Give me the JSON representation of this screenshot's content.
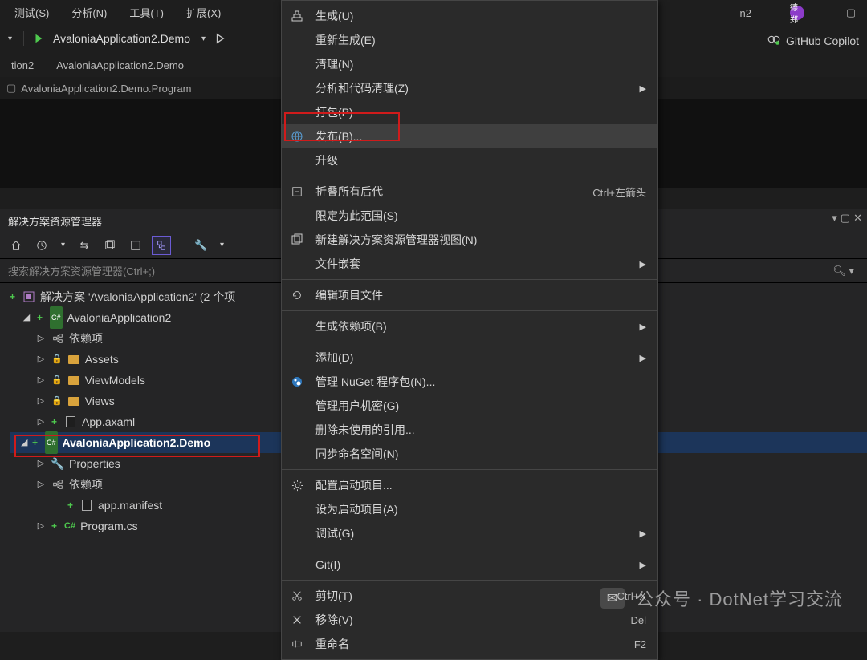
{
  "menubar": {
    "items": [
      "测试(S)",
      "分析(N)",
      "工具(T)",
      "扩展(X)"
    ]
  },
  "titlebar": {
    "app_title": "n2",
    "user_avatar": "德郑"
  },
  "copilot": {
    "label": "GitHub Copilot"
  },
  "run": {
    "target": "AvaloniaApplication2.Demo"
  },
  "tabs": [
    "tion2",
    "AvaloniaApplication2.Demo"
  ],
  "breadcrumb": "AvaloniaApplication2.Demo.Program",
  "solution_explorer": {
    "title": "解决方案资源管理器",
    "search_placeholder": "搜索解决方案资源管理器(Ctrl+;)",
    "nodes": {
      "root": "解决方案 'AvaloniaApplication2' (2 个项",
      "proj1": "AvaloniaApplication2",
      "proj1_children": [
        "依赖项",
        "Assets",
        "ViewModels",
        "Views",
        "App.axaml"
      ],
      "proj2": "AvaloniaApplication2.Demo",
      "proj2_children": [
        "Properties",
        "依赖项",
        "app.manifest",
        "Program.cs"
      ]
    }
  },
  "context_menu": {
    "items": [
      {
        "icon": "build-icon",
        "label": "生成(U)",
        "shortcut": "",
        "sub": false
      },
      {
        "icon": "",
        "label": "重新生成(E)",
        "shortcut": "",
        "sub": false
      },
      {
        "icon": "",
        "label": "清理(N)",
        "shortcut": "",
        "sub": false
      },
      {
        "icon": "",
        "label": "分析和代码清理(Z)",
        "shortcut": "",
        "sub": true
      },
      {
        "icon": "",
        "label": "打包(P)",
        "shortcut": "",
        "sub": false
      },
      {
        "icon": "globe-icon",
        "label": "发布(B)...",
        "shortcut": "",
        "sub": false,
        "hover": true
      },
      {
        "icon": "",
        "label": "升级",
        "shortcut": "",
        "sub": false
      },
      {
        "sep": true
      },
      {
        "icon": "collapse-icon",
        "label": "折叠所有后代",
        "shortcut": "Ctrl+左箭头",
        "sub": false
      },
      {
        "icon": "",
        "label": "限定为此范围(S)",
        "shortcut": "",
        "sub": false
      },
      {
        "icon": "newview-icon",
        "label": "新建解决方案资源管理器视图(N)",
        "shortcut": "",
        "sub": false
      },
      {
        "icon": "",
        "label": "文件嵌套",
        "shortcut": "",
        "sub": true
      },
      {
        "sep": true
      },
      {
        "icon": "refresh-icon",
        "label": "编辑项目文件",
        "shortcut": "",
        "sub": false
      },
      {
        "sep": true
      },
      {
        "icon": "",
        "label": "生成依赖项(B)",
        "shortcut": "",
        "sub": true
      },
      {
        "sep": true
      },
      {
        "icon": "",
        "label": "添加(D)",
        "shortcut": "",
        "sub": true
      },
      {
        "icon": "nuget-icon",
        "label": "管理 NuGet 程序包(N)...",
        "shortcut": "",
        "sub": false
      },
      {
        "icon": "",
        "label": "管理用户机密(G)",
        "shortcut": "",
        "sub": false
      },
      {
        "icon": "",
        "label": "删除未使用的引用...",
        "shortcut": "",
        "sub": false
      },
      {
        "icon": "",
        "label": "同步命名空间(N)",
        "shortcut": "",
        "sub": false
      },
      {
        "sep": true
      },
      {
        "icon": "gear-icon",
        "label": "配置启动项目...",
        "shortcut": "",
        "sub": false
      },
      {
        "icon": "",
        "label": "设为启动项目(A)",
        "shortcut": "",
        "sub": false
      },
      {
        "icon": "",
        "label": "调试(G)",
        "shortcut": "",
        "sub": true
      },
      {
        "sep": true
      },
      {
        "icon": "",
        "label": "Git(I)",
        "shortcut": "",
        "sub": true
      },
      {
        "sep": true
      },
      {
        "icon": "cut-icon",
        "label": "剪切(T)",
        "shortcut": "Ctrl+X",
        "sub": false
      },
      {
        "icon": "delete-icon",
        "label": "移除(V)",
        "shortcut": "Del",
        "sub": false
      },
      {
        "icon": "rename-icon",
        "label": "重命名",
        "shortcut": "F2",
        "sub": false
      }
    ]
  },
  "watermark": "公众号 · DotNet学习交流"
}
